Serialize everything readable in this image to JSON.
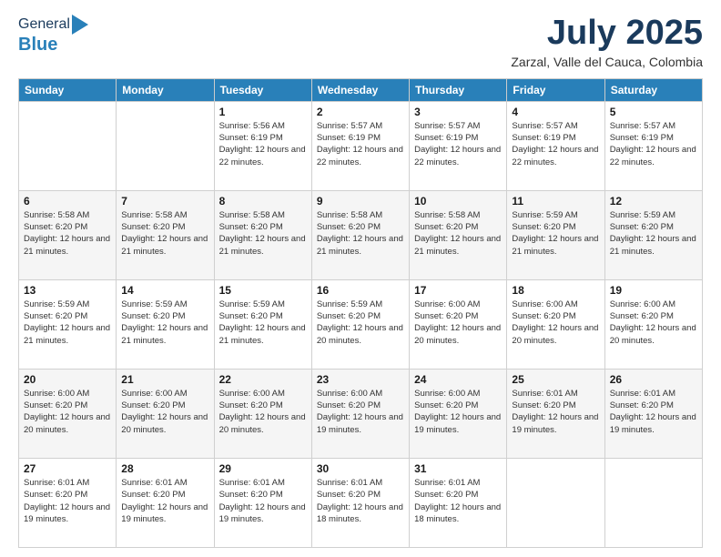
{
  "logo": {
    "general": "General",
    "blue": "Blue"
  },
  "header": {
    "month": "July 2025",
    "location": "Zarzal, Valle del Cauca, Colombia"
  },
  "weekdays": [
    "Sunday",
    "Monday",
    "Tuesday",
    "Wednesday",
    "Thursday",
    "Friday",
    "Saturday"
  ],
  "weeks": [
    [
      {
        "day": "",
        "info": ""
      },
      {
        "day": "",
        "info": ""
      },
      {
        "day": "1",
        "info": "Sunrise: 5:56 AM\nSunset: 6:19 PM\nDaylight: 12 hours and 22 minutes."
      },
      {
        "day": "2",
        "info": "Sunrise: 5:57 AM\nSunset: 6:19 PM\nDaylight: 12 hours and 22 minutes."
      },
      {
        "day": "3",
        "info": "Sunrise: 5:57 AM\nSunset: 6:19 PM\nDaylight: 12 hours and 22 minutes."
      },
      {
        "day": "4",
        "info": "Sunrise: 5:57 AM\nSunset: 6:19 PM\nDaylight: 12 hours and 22 minutes."
      },
      {
        "day": "5",
        "info": "Sunrise: 5:57 AM\nSunset: 6:19 PM\nDaylight: 12 hours and 22 minutes."
      }
    ],
    [
      {
        "day": "6",
        "info": "Sunrise: 5:58 AM\nSunset: 6:20 PM\nDaylight: 12 hours and 21 minutes."
      },
      {
        "day": "7",
        "info": "Sunrise: 5:58 AM\nSunset: 6:20 PM\nDaylight: 12 hours and 21 minutes."
      },
      {
        "day": "8",
        "info": "Sunrise: 5:58 AM\nSunset: 6:20 PM\nDaylight: 12 hours and 21 minutes."
      },
      {
        "day": "9",
        "info": "Sunrise: 5:58 AM\nSunset: 6:20 PM\nDaylight: 12 hours and 21 minutes."
      },
      {
        "day": "10",
        "info": "Sunrise: 5:58 AM\nSunset: 6:20 PM\nDaylight: 12 hours and 21 minutes."
      },
      {
        "day": "11",
        "info": "Sunrise: 5:59 AM\nSunset: 6:20 PM\nDaylight: 12 hours and 21 minutes."
      },
      {
        "day": "12",
        "info": "Sunrise: 5:59 AM\nSunset: 6:20 PM\nDaylight: 12 hours and 21 minutes."
      }
    ],
    [
      {
        "day": "13",
        "info": "Sunrise: 5:59 AM\nSunset: 6:20 PM\nDaylight: 12 hours and 21 minutes."
      },
      {
        "day": "14",
        "info": "Sunrise: 5:59 AM\nSunset: 6:20 PM\nDaylight: 12 hours and 21 minutes."
      },
      {
        "day": "15",
        "info": "Sunrise: 5:59 AM\nSunset: 6:20 PM\nDaylight: 12 hours and 21 minutes."
      },
      {
        "day": "16",
        "info": "Sunrise: 5:59 AM\nSunset: 6:20 PM\nDaylight: 12 hours and 20 minutes."
      },
      {
        "day": "17",
        "info": "Sunrise: 6:00 AM\nSunset: 6:20 PM\nDaylight: 12 hours and 20 minutes."
      },
      {
        "day": "18",
        "info": "Sunrise: 6:00 AM\nSunset: 6:20 PM\nDaylight: 12 hours and 20 minutes."
      },
      {
        "day": "19",
        "info": "Sunrise: 6:00 AM\nSunset: 6:20 PM\nDaylight: 12 hours and 20 minutes."
      }
    ],
    [
      {
        "day": "20",
        "info": "Sunrise: 6:00 AM\nSunset: 6:20 PM\nDaylight: 12 hours and 20 minutes."
      },
      {
        "day": "21",
        "info": "Sunrise: 6:00 AM\nSunset: 6:20 PM\nDaylight: 12 hours and 20 minutes."
      },
      {
        "day": "22",
        "info": "Sunrise: 6:00 AM\nSunset: 6:20 PM\nDaylight: 12 hours and 20 minutes."
      },
      {
        "day": "23",
        "info": "Sunrise: 6:00 AM\nSunset: 6:20 PM\nDaylight: 12 hours and 19 minutes."
      },
      {
        "day": "24",
        "info": "Sunrise: 6:00 AM\nSunset: 6:20 PM\nDaylight: 12 hours and 19 minutes."
      },
      {
        "day": "25",
        "info": "Sunrise: 6:01 AM\nSunset: 6:20 PM\nDaylight: 12 hours and 19 minutes."
      },
      {
        "day": "26",
        "info": "Sunrise: 6:01 AM\nSunset: 6:20 PM\nDaylight: 12 hours and 19 minutes."
      }
    ],
    [
      {
        "day": "27",
        "info": "Sunrise: 6:01 AM\nSunset: 6:20 PM\nDaylight: 12 hours and 19 minutes."
      },
      {
        "day": "28",
        "info": "Sunrise: 6:01 AM\nSunset: 6:20 PM\nDaylight: 12 hours and 19 minutes."
      },
      {
        "day": "29",
        "info": "Sunrise: 6:01 AM\nSunset: 6:20 PM\nDaylight: 12 hours and 19 minutes."
      },
      {
        "day": "30",
        "info": "Sunrise: 6:01 AM\nSunset: 6:20 PM\nDaylight: 12 hours and 18 minutes."
      },
      {
        "day": "31",
        "info": "Sunrise: 6:01 AM\nSunset: 6:20 PM\nDaylight: 12 hours and 18 minutes."
      },
      {
        "day": "",
        "info": ""
      },
      {
        "day": "",
        "info": ""
      }
    ]
  ]
}
